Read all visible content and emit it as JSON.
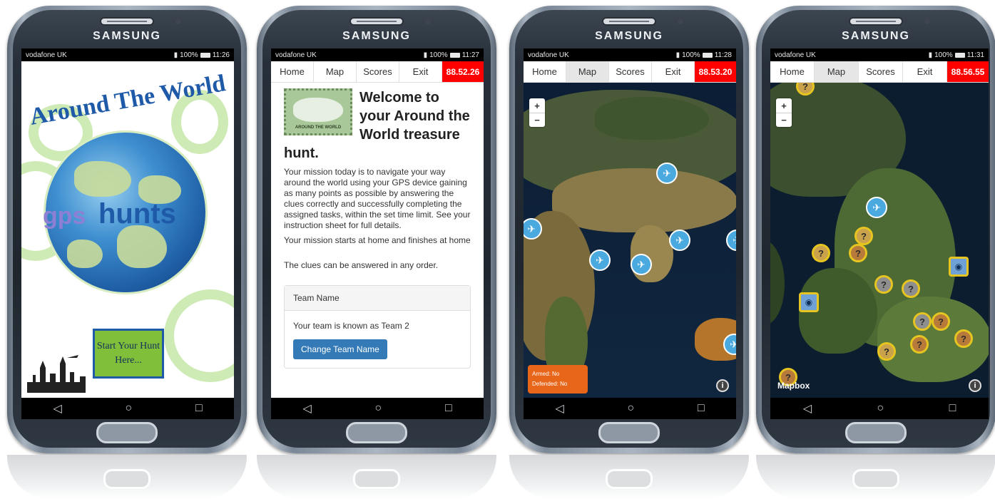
{
  "brand": "SAMSUNG",
  "phones": [
    {
      "carrier": "vodafone UK",
      "battery": "100%",
      "time": "11:26",
      "splash": {
        "title": "Around The World",
        "logo_gps": "gps",
        "logo_hunts": "hunts",
        "start_button": "Start Your Hunt Here..."
      }
    },
    {
      "carrier": "vodafone UK",
      "battery": "100%",
      "time": "11:27",
      "timer": "88.52.26",
      "stamp_caption": "AROUND THE WORLD",
      "heading": "Welcome to your Around the World treasure hunt.",
      "paragraphs": [
        "Your mission today is to navigate your way around the world using your GPS device gaining as many points as possible by answering the clues correctly and successfully completing the assigned tasks, within the set time limit. See your instruction sheet for full details.",
        "Your mission starts at home and finishes at home",
        "The clues can be answered in any order."
      ],
      "card_title": "Team Name",
      "card_text": "Your team is known as Team 2",
      "card_button": "Change Team Name"
    },
    {
      "carrier": "vodafone UK",
      "battery": "100%",
      "time": "11:28",
      "timer": "88.53.20",
      "armed": "Armed: No",
      "defended": "Defended: No"
    },
    {
      "carrier": "vodafone UK",
      "battery": "100%",
      "time": "11:31",
      "timer": "88.56.55",
      "map_attribution": "Mapbox"
    }
  ],
  "nav_tabs": [
    "Home",
    "Map",
    "Scores",
    "Exit"
  ],
  "zoom": {
    "in": "+",
    "out": "−"
  },
  "info": "i",
  "navbar_icons": [
    "back-icon",
    "home-icon",
    "recents-icon"
  ],
  "colors": {
    "timer_bg": "#ff0000",
    "primary_button": "#337ab7",
    "armed_bg": "#e8661a"
  }
}
